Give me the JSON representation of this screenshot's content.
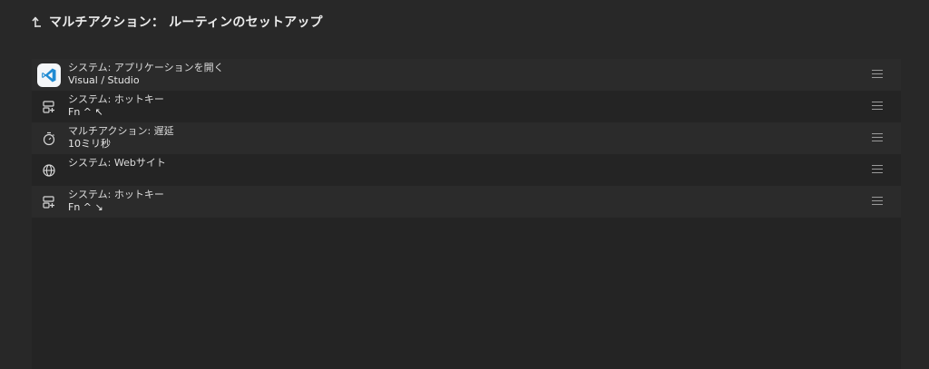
{
  "header": {
    "back_icon": "return-arrow-icon",
    "title": "マルチアクション： ルーティンのセットアップ"
  },
  "actions": [
    {
      "icon": "vscode-app-icon",
      "title": "システム: アプリケーションを開く",
      "detail": "Visual / Studio"
    },
    {
      "icon": "hotkey-icon",
      "title": "システム: ホットキー",
      "detail": "Fn ^ ↖"
    },
    {
      "icon": "stopwatch-icon",
      "title": "マルチアクション: 遅延",
      "detail": "10ミリ秒"
    },
    {
      "icon": "globe-icon",
      "title": "システム: Webサイト",
      "detail": ""
    },
    {
      "icon": "hotkey-icon",
      "title": "システム: ホットキー",
      "detail": "Fn ^ ↘"
    }
  ],
  "colors": {
    "background": "#282828",
    "panel": "#242424",
    "row_shade": "#2b2b2b",
    "vscode_blue": "#1f8ad2"
  }
}
